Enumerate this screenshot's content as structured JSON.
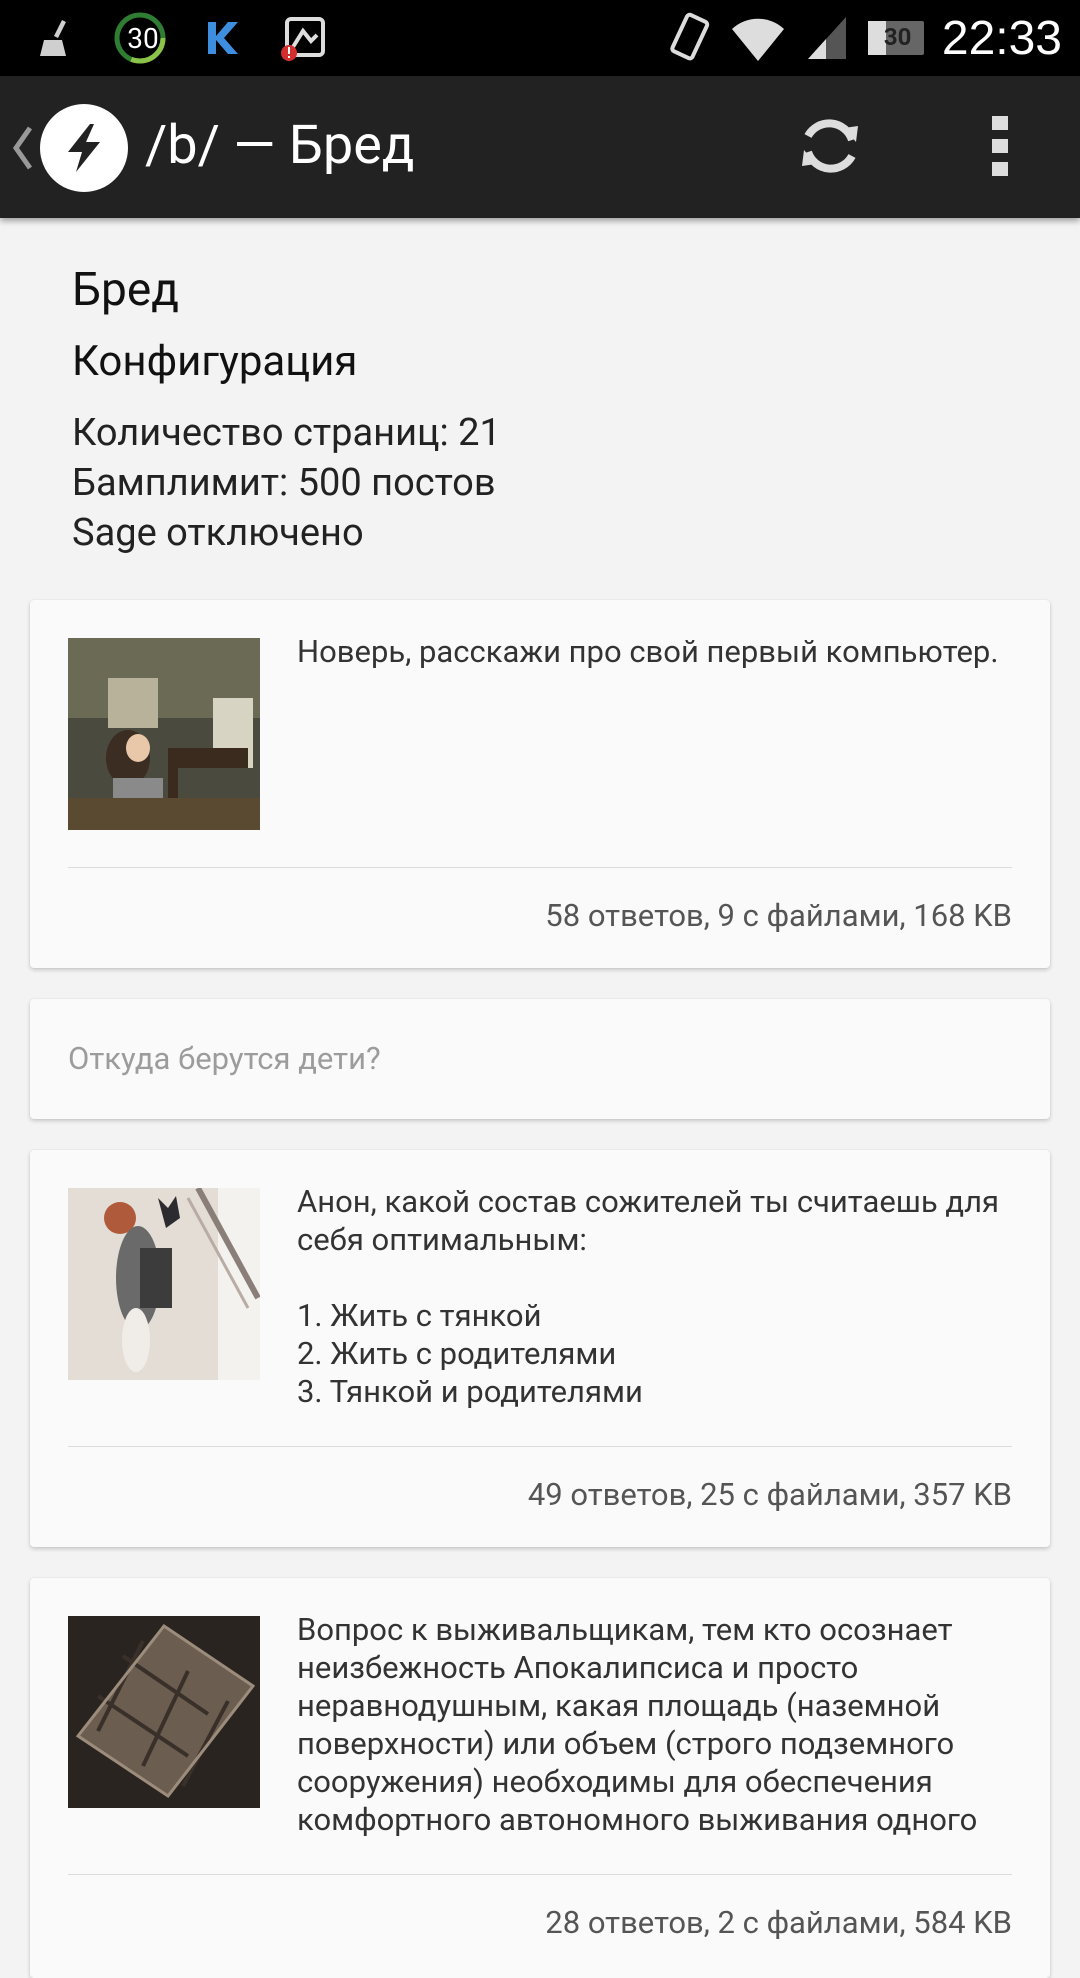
{
  "status_bar": {
    "time": "22:33",
    "battery": "30",
    "notification_badge": "30",
    "icons": [
      "broom-icon",
      "battery-circle-icon",
      "k-app-icon",
      "photo-alert-icon",
      "vibrate-icon",
      "wifi-icon",
      "signal-icon",
      "battery-icon"
    ]
  },
  "app_bar": {
    "title": "/b/ — Бред",
    "icons": [
      "chevron-left-icon",
      "lightning-logo-icon",
      "refresh-icon",
      "overflow-menu-icon"
    ]
  },
  "board_info": {
    "name": "Бред",
    "config_heading": "Конфигурация",
    "pages": "Количество страниц: 21",
    "bumplimit": "Бамплимит: 500 постов",
    "sage": "Sage отключено"
  },
  "threads": [
    {
      "text": "Новерь, расскажи про свой первый компьютер.",
      "stats": "58 ответов, 9 с файлами, 168 KB",
      "thumbnail": "girl-at-old-computer-thumbnail"
    },
    {
      "text": "Откуда берутся дети?",
      "stats": "",
      "thumbnail": ""
    },
    {
      "text": "Анон, какой состав сожителей ты считаешь для себя оптимальным:\n\n1. Жить с тянкой\n2. Жить с родителями\n3. Тянкой и родителями",
      "stats": "49 ответов, 25 с файлами, 357 KB",
      "thumbnail": "girl-lying-on-bed-thumbnail"
    },
    {
      "text": "Вопрос к выживальщикам, тем кто осознает неизбежность Апокалипсиса и просто неравнодушным, какая площадь (наземной поверхности) или объем (строго подземного сооружения) необходимы для обеспечения комфортного автономного выживания одного",
      "stats": "28 ответов, 2 с файлами, 584 KB",
      "thumbnail": "bunker-floorplan-thumbnail"
    }
  ]
}
